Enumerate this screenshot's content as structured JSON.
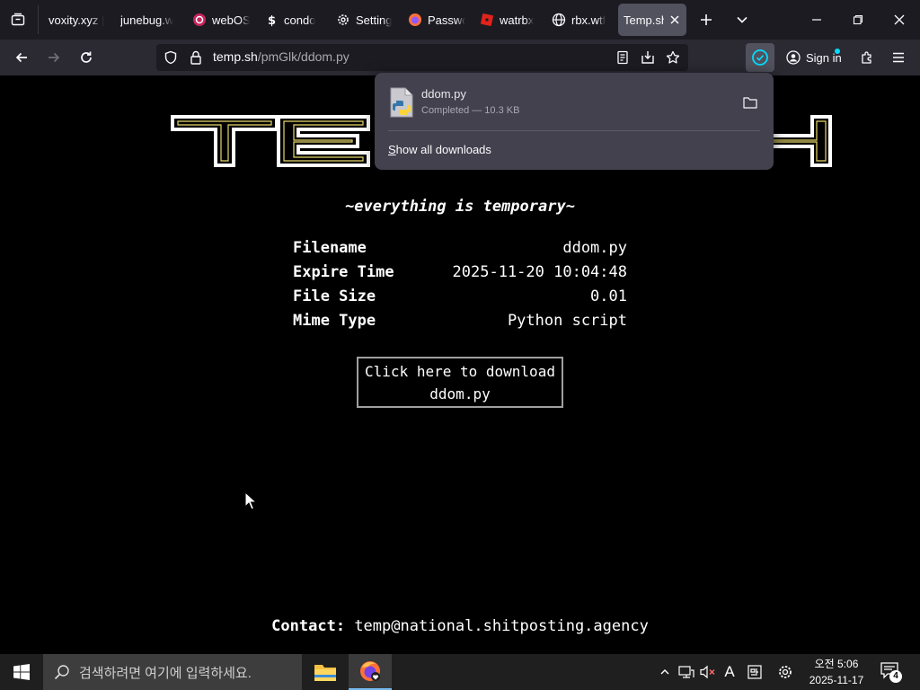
{
  "tabs": [
    {
      "title": "voxity.xyz |",
      "icon": "none-icon",
      "active": false
    },
    {
      "title": "junebug.w",
      "icon": "none-icon",
      "active": false
    },
    {
      "title": "webOS",
      "icon": "webos-icon",
      "active": false
    },
    {
      "title": "condo",
      "icon": "s-icon",
      "active": false
    },
    {
      "title": "Setting",
      "icon": "gear-icon",
      "active": false
    },
    {
      "title": "Passwo",
      "icon": "firefox-icon",
      "active": false
    },
    {
      "title": "watrbx",
      "icon": "roblox-icon",
      "active": false
    },
    {
      "title": "rbx.wtf",
      "icon": "globe-icon",
      "active": false
    },
    {
      "title": "Temp.sh",
      "icon": "none-icon",
      "active": true
    }
  ],
  "urlbar": {
    "domain": "temp.sh",
    "path": "/pmGlk/ddom.py"
  },
  "signin_label": "Sign in",
  "downloads_panel": {
    "file_name": "ddom.py",
    "status": "Completed — 10.3 KB",
    "show_all_prefix": "S",
    "show_all_rest": "how all downloads"
  },
  "page": {
    "logo_text": "TEMP.SH",
    "tagline": "~everything is temporary~",
    "info_rows": [
      {
        "key": "Filename",
        "value": "ddom.py"
      },
      {
        "key": "Expire Time",
        "value": "2025-11-20 10:04:48"
      },
      {
        "key": "File Size",
        "value": "0.01"
      },
      {
        "key": "Mime Type",
        "value": "Python script"
      }
    ],
    "download_line1": "Click here to download",
    "download_line2": "ddom.py",
    "contact_label": "Contact:",
    "contact_value": "temp@national.shitposting.agency"
  },
  "taskbar": {
    "search_placeholder": "검색하려면 여기에 입력하세요.",
    "ime_label": "A",
    "clock_time": "오전 5:06",
    "clock_date": "2025-11-17",
    "notification_count": "4"
  },
  "colors": {
    "accent": "#00ddff",
    "tab_active": "#52525e",
    "toolbar": "#2b2a33"
  }
}
